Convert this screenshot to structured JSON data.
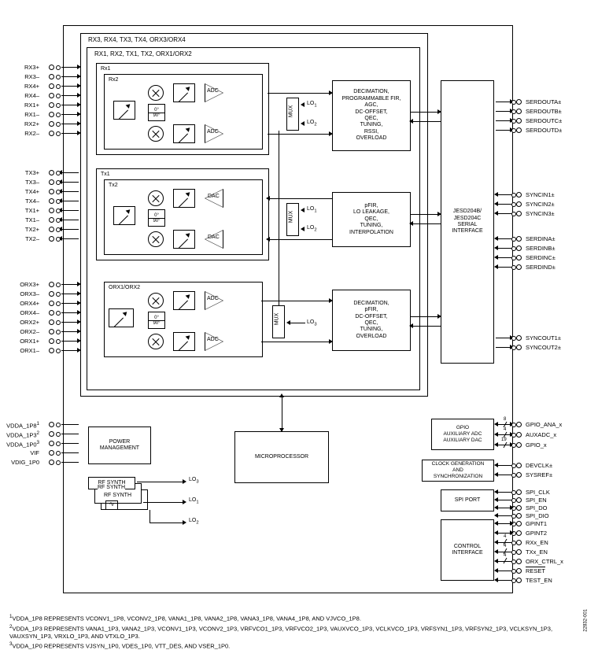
{
  "outer_label_top": "RX3, RX4, TX3, TX4, ORX3/ORX4",
  "inner_label_top": "RX1, RX2, TX1, TX2, ORX1/ORX2",
  "rx_block": {
    "outer": "Rx1",
    "inner": "Rx2",
    "conv1": "ADC",
    "conv2": "ADC"
  },
  "tx_block": {
    "outer": "Tx1",
    "inner": "Tx2",
    "conv1": "DAC",
    "conv2": "DAC"
  },
  "orx_block": {
    "inner": "ORX1/ORX2",
    "conv1": "ADC",
    "conv2": "ADC"
  },
  "mux_label": "MUX",
  "lo": {
    "lo1": "LO",
    "lo2": "LO",
    "lo3": "LO",
    "sub1": "1",
    "sub2": "2",
    "sub3": "3"
  },
  "dsp_rx": "DECIMATION,\nPROGRAMMABLE FIR,\nAGC,\nDC-OFFSET,\nQEC,\nTUNING,\nRSSI,\nOVERLOAD",
  "dsp_tx": "pFIR,\nLO LEAKAGE,\nQEC,\nTUNING,\nINTERPOLATION",
  "dsp_orx": "DECIMATION,\npFIR,\nDC-OFFSET,\nQEC,\nTUNING,\nOVERLOAD",
  "jesd": "JESD204B/\nJESD204C\nSERIAL\nINTERFACE",
  "power_mgmt": "POWER\nMANAGEMENT",
  "microprocessor": "MICROPROCESSOR",
  "rf_synth": "RF SYNTH",
  "gpio_block": "GPIO\nAUXILIARY ADC\nAUXILIARY DAC",
  "clock_block": "CLOCK GENERATION\nAND\nSYNCHRONIZATION",
  "spi_block": "SPI PORT",
  "ctrl_block": "CONTROL\nINTERFACE",
  "phase0": "0°",
  "phase90": "90°",
  "bus_counts": {
    "gpio_ana": "8",
    "auxadc": "4",
    "gpio": "19",
    "rxx": "4",
    "txx": "4",
    "orx": "4"
  },
  "pins_left_rx": [
    "RX3+",
    "RX3–",
    "RX4+",
    "RX4–",
    "RX1+",
    "RX1–",
    "RX2+",
    "RX2–"
  ],
  "pins_left_tx": [
    "TX3+",
    "TX3–",
    "TX4+",
    "TX4–",
    "TX1+",
    "TX1–",
    "TX2+",
    "TX2–"
  ],
  "pins_left_orx": [
    "ORX3+",
    "ORX3–",
    "ORX4+",
    "ORX4–",
    "ORX2+",
    "ORX2–",
    "ORX1+",
    "ORX1–"
  ],
  "pins_left_pwr": [
    "VDDA_1P8",
    "VDDA_1P3",
    "VDDA_1P0",
    "VIF",
    "VDIG_1P0"
  ],
  "pins_left_pwr_sup": [
    "1",
    "2",
    "3",
    "",
    ""
  ],
  "pins_right_serdout": [
    "SERDOUTA±",
    "SERDOUTB±",
    "SERDOUTC±",
    "SERDOUTD±"
  ],
  "pins_right_syncin": [
    "SYNCIN1±",
    "SYNCIN2±",
    "SYNCIN3±"
  ],
  "pins_right_serdin": [
    "SERDINA±",
    "SERDINB±",
    "SERDINC±",
    "SERDIND±"
  ],
  "pins_right_syncout": [
    "SYNCOUT1±",
    "SYNCOUT2±"
  ],
  "pins_right_gpio": [
    "GPIO_ANA_x",
    "AUXADC_x",
    "GPIO_x"
  ],
  "pins_right_clk": [
    "DEVCLK±",
    "SYSREF±"
  ],
  "pins_right_spi": [
    "SPI_CLK",
    "SPI_EN",
    "SPI_DO",
    "SPI_DIO"
  ],
  "pins_right_ctrl": [
    "GPINT1",
    "GPINT2",
    "RXx_EN",
    "TXx_EN",
    "ORX_CTRL_x",
    "RESET",
    "TEST_EN"
  ],
  "footnote1": "VDDA_1P8 REPRESENTS VCONV1_1P8, VCONV2_1P8, VANA1_1P8, VANA2_1P8, VANA3_1P8, VANA4_1P8, AND VJVCO_1P8.",
  "footnote2": "VDDA_1P3 REPRESENTS VANA1_1P3, VANA2_1P3, VCONV1_1P3, VCONV2_1P3, VRFVCO1_1P3, VRFVCO2_1P3, VAUXVCO_1P3, VCLKVCO_1P3, VRFSYN1_1P3, VRFSYN2_1P3, VCLKSYN_1P3, VAUXSYN_1P3, VRXLO_1P3, AND VTXLO_1P3.",
  "footnote3": "VDDA_1P0 REPRESENTS VJSYN_1P0, VDES_1P0, VTT_DES, AND VSER_1P0.",
  "fn_sup1": "1",
  "fn_sup2": "2",
  "fn_sup3": "3",
  "figure_id": "22832-001",
  "overline": "‾‾‾‾‾"
}
